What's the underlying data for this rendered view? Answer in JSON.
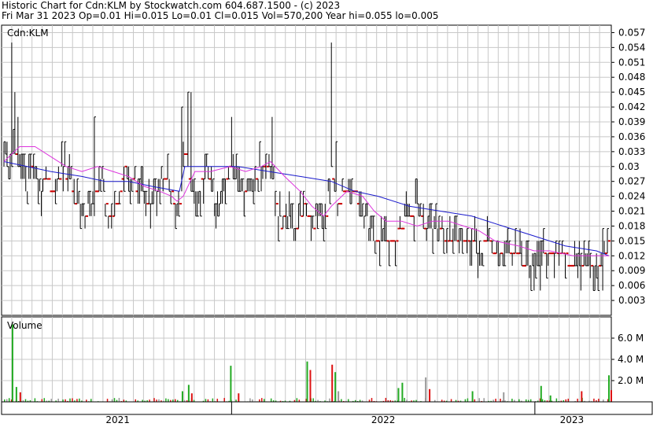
{
  "header": {
    "line1": "Historic Chart for Cdn:KLM by Stockwatch.com 604.687.1500 - (c) 2023",
    "line2": "Fri Mar 31 2023   Op=0.01   Hi=0.015   Lo=0.01   Cl=0.015   Vol=570,200   Year hi=0.055   lo=0.005"
  },
  "colors": {
    "price_bar": "#000000",
    "flat_tick": "#cc0000",
    "ma_short": "#dd33dd",
    "ma_long": "#1a1acc",
    "vol_up": "#22aa22",
    "vol_down": "#dd1111",
    "vol_flat": "#999999",
    "grid": "#c8c8c8"
  },
  "chart_data": [
    {
      "type": "line",
      "title": "Cdn:KLM",
      "ylim": [
        0,
        0.0585
      ],
      "yticks": [
        "0.057",
        "0.054",
        "0.051",
        "0.048",
        "0.045",
        "0.042",
        "0.039",
        "0.036",
        "0.033",
        "0.03",
        "0.027",
        "0.024",
        "0.021",
        "0.018",
        "0.015",
        "0.012",
        "0.009",
        "0.006",
        "0.003"
      ],
      "price_step": 0.0025,
      "price_knots": [
        [
          0,
          0.035
        ],
        [
          5,
          0.03
        ],
        [
          14,
          0.033
        ],
        [
          24,
          0.028
        ],
        [
          30,
          0.025
        ],
        [
          36,
          0.03
        ],
        [
          45,
          0.025
        ],
        [
          55,
          0.028
        ],
        [
          65,
          0.024
        ],
        [
          75,
          0.03
        ],
        [
          85,
          0.027
        ],
        [
          95,
          0.022
        ],
        [
          105,
          0.02
        ],
        [
          115,
          0.025
        ],
        [
          125,
          0.027
        ],
        [
          135,
          0.02
        ],
        [
          145,
          0.022
        ],
        [
          155,
          0.03
        ],
        [
          165,
          0.027
        ],
        [
          175,
          0.025
        ],
        [
          185,
          0.022
        ],
        [
          195,
          0.025
        ],
        [
          205,
          0.028
        ],
        [
          215,
          0.025
        ],
        [
          225,
          0.02
        ],
        [
          233,
          0.035
        ],
        [
          240,
          0.025
        ],
        [
          250,
          0.025
        ],
        [
          262,
          0.03
        ],
        [
          272,
          0.022
        ],
        [
          282,
          0.025
        ],
        [
          292,
          0.03
        ],
        [
          302,
          0.025
        ],
        [
          312,
          0.025
        ],
        [
          322,
          0.028
        ],
        [
          335,
          0.03
        ],
        [
          345,
          0.028
        ],
        [
          355,
          0.018
        ],
        [
          365,
          0.02
        ],
        [
          375,
          0.018
        ],
        [
          385,
          0.022
        ],
        [
          395,
          0.018
        ],
        [
          405,
          0.02
        ],
        [
          412,
          0.018
        ],
        [
          420,
          0.03
        ],
        [
          428,
          0.022
        ],
        [
          438,
          0.025
        ],
        [
          450,
          0.025
        ],
        [
          460,
          0.02
        ],
        [
          470,
          0.018
        ],
        [
          480,
          0.015
        ],
        [
          490,
          0.015
        ],
        [
          500,
          0.015
        ],
        [
          510,
          0.018
        ],
        [
          520,
          0.02
        ],
        [
          530,
          0.022
        ],
        [
          540,
          0.018
        ],
        [
          550,
          0.018
        ],
        [
          560,
          0.018
        ],
        [
          570,
          0.015
        ],
        [
          580,
          0.015
        ],
        [
          590,
          0.015
        ],
        [
          600,
          0.015
        ],
        [
          610,
          0.012
        ],
        [
          620,
          0.015
        ],
        [
          630,
          0.012
        ],
        [
          640,
          0.012
        ],
        [
          650,
          0.012
        ],
        [
          660,
          0.012
        ],
        [
          670,
          0.01
        ],
        [
          680,
          0.01
        ],
        [
          690,
          0.012
        ],
        [
          700,
          0.012
        ],
        [
          710,
          0.012
        ],
        [
          720,
          0.012
        ],
        [
          730,
          0.01
        ],
        [
          740,
          0.01
        ],
        [
          750,
          0.01
        ],
        [
          760,
          0.01
        ],
        [
          770,
          0.012
        ],
        [
          776,
          0.015
        ]
      ],
      "spikes": [
        [
          10,
          0.055
        ],
        [
          14,
          0.045
        ],
        [
          18,
          0.04
        ],
        [
          228,
          0.042
        ],
        [
          236,
          0.045
        ],
        [
          240,
          0.045
        ],
        [
          292,
          0.04
        ],
        [
          420,
          0.055
        ],
        [
          423,
          0.04
        ],
        [
          426,
          0.035
        ],
        [
          116,
          0.04
        ],
        [
          344,
          0.04
        ],
        [
          775,
          0.02
        ]
      ],
      "dips": [
        [
          183,
          0.015
        ],
        [
          213,
          0.015
        ],
        [
          355,
          0.015
        ],
        [
          383,
          0.015
        ],
        [
          485,
          0.01
        ],
        [
          545,
          0.01
        ],
        [
          600,
          0.01
        ],
        [
          680,
          0.005
        ],
        [
          688,
          0.005
        ],
        [
          740,
          0.005
        ],
        [
          755,
          0.005
        ],
        [
          768,
          0.005
        ]
      ],
      "series": [
        {
          "values": [
            [
              0,
              0.031
            ],
            [
              30,
              0.03
            ],
            [
              60,
              0.029
            ],
            [
              100,
              0.028
            ],
            [
              130,
              0.027
            ],
            [
              160,
              0.027
            ],
            [
              190,
              0.026
            ],
            [
              225,
              0.025
            ],
            [
              232,
              0.03
            ],
            [
              260,
              0.03
            ],
            [
              300,
              0.03
            ],
            [
              340,
              0.029
            ],
            [
              380,
              0.028
            ],
            [
              420,
              0.027
            ],
            [
              450,
              0.025
            ],
            [
              480,
              0.024
            ],
            [
              520,
              0.022
            ],
            [
              560,
              0.021
            ],
            [
              600,
              0.02
            ],
            [
              640,
              0.018
            ],
            [
              680,
              0.016
            ],
            [
              720,
              0.014
            ],
            [
              760,
              0.013
            ],
            [
              776,
              0.012
            ]
          ]
        },
        {
          "values": [
            [
              0,
              0.031
            ],
            [
              20,
              0.034
            ],
            [
              40,
              0.034
            ],
            [
              60,
              0.032
            ],
            [
              80,
              0.03
            ],
            [
              100,
              0.029
            ],
            [
              120,
              0.03
            ],
            [
              140,
              0.029
            ],
            [
              160,
              0.028
            ],
            [
              180,
              0.026
            ],
            [
              200,
              0.025
            ],
            [
              215,
              0.024
            ],
            [
              222,
              0.023
            ],
            [
              230,
              0.024
            ],
            [
              245,
              0.029
            ],
            [
              265,
              0.029
            ],
            [
              290,
              0.03
            ],
            [
              310,
              0.029
            ],
            [
              330,
              0.03
            ],
            [
              342,
              0.031
            ],
            [
              360,
              0.028
            ],
            [
              380,
              0.025
            ],
            [
              395,
              0.022
            ],
            [
              410,
              0.02
            ],
            [
              420,
              0.022
            ],
            [
              440,
              0.025
            ],
            [
              460,
              0.024
            ],
            [
              475,
              0.021
            ],
            [
              490,
              0.019
            ],
            [
              510,
              0.019
            ],
            [
              530,
              0.018
            ],
            [
              550,
              0.019
            ],
            [
              570,
              0.019
            ],
            [
              590,
              0.018
            ],
            [
              610,
              0.017
            ],
            [
              630,
              0.015
            ],
            [
              660,
              0.014
            ],
            [
              680,
              0.013
            ],
            [
              700,
              0.013
            ],
            [
              730,
              0.012
            ],
            [
              755,
              0.012
            ],
            [
              776,
              0.012
            ]
          ]
        }
      ]
    },
    {
      "type": "bar",
      "title": "Volume",
      "ylim": [
        0,
        8000000
      ],
      "yticks": [
        "6.0 M",
        "4.0 M",
        "2.0 M"
      ],
      "spikes": [
        [
          10,
          7.3,
          "up"
        ],
        [
          15,
          1.4,
          "up"
        ],
        [
          20,
          0.9,
          "down"
        ],
        [
          228,
          1.0,
          "up"
        ],
        [
          236,
          1.6,
          "up"
        ],
        [
          240,
          0.8,
          "down"
        ],
        [
          290,
          3.4,
          "up"
        ],
        [
          300,
          0.8,
          "down"
        ],
        [
          388,
          3.8,
          "up"
        ],
        [
          392,
          3.0,
          "down"
        ],
        [
          420,
          3.5,
          "down"
        ],
        [
          424,
          2.8,
          "up"
        ],
        [
          428,
          1.0,
          "flat"
        ],
        [
          505,
          1.3,
          "up"
        ],
        [
          510,
          1.8,
          "up"
        ],
        [
          540,
          2.3,
          "flat"
        ],
        [
          545,
          1.2,
          "down"
        ],
        [
          600,
          1.0,
          "up"
        ],
        [
          640,
          0.9,
          "flat"
        ],
        [
          688,
          1.5,
          "up"
        ],
        [
          700,
          0.6,
          "up"
        ],
        [
          740,
          1.0,
          "down"
        ],
        [
          775,
          2.5,
          "up"
        ],
        [
          778,
          1.1,
          "down"
        ]
      ]
    },
    {
      "type": "table",
      "categories": [
        "2021",
        "2022",
        "2023"
      ]
    }
  ]
}
